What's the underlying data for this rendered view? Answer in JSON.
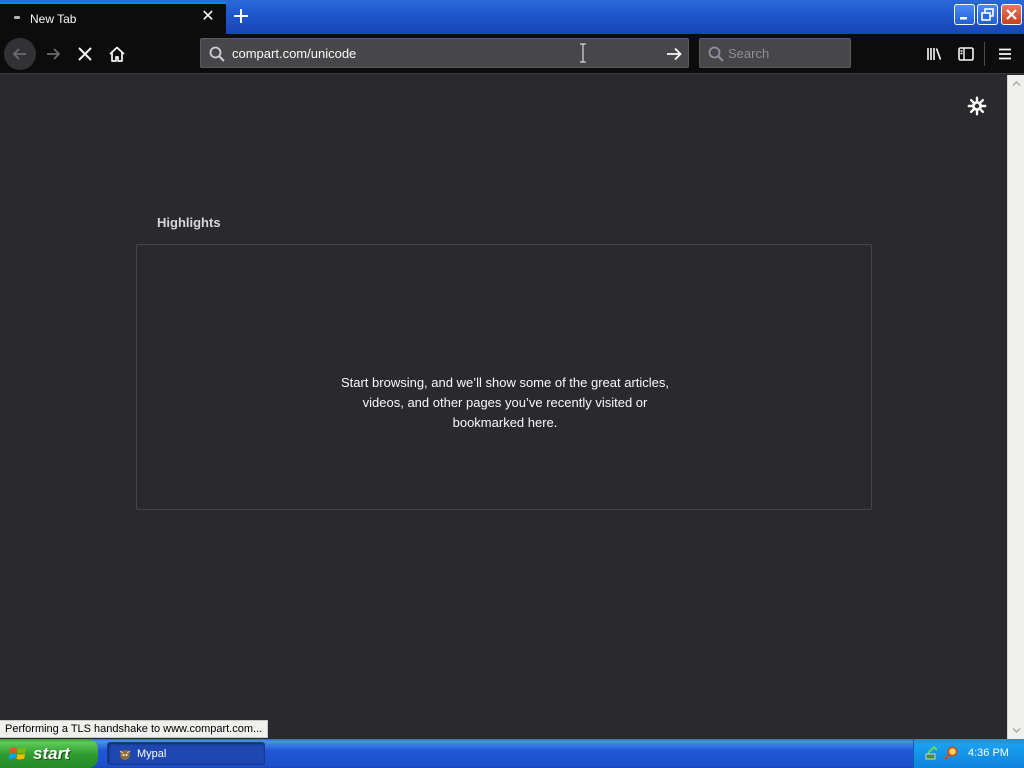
{
  "browser": {
    "tab": {
      "title": "New Tab",
      "close_icon": "close-icon"
    },
    "window_controls": [
      "minimize-icon",
      "restore-icon",
      "close-icon"
    ],
    "urlbar": {
      "value": "compart.com/unicode"
    },
    "searchbar": {
      "placeholder": "Search"
    },
    "toolbar_icons": [
      "back-arrow-icon",
      "forward-arrow-icon",
      "stop-icon",
      "home-icon",
      "library-icon",
      "sidebar-icon",
      "hamburger-menu-icon"
    ]
  },
  "newtab": {
    "highlights_title": "Highlights",
    "highlights_message": "Start browsing, and we’ll show some of the great articles, videos, and other pages you’ve recently visited or bookmarked here."
  },
  "status_bar": {
    "text": "Performing a TLS handshake to www.compart.com..."
  },
  "taskbar": {
    "start_label": "start",
    "tasks": [
      {
        "label": "Mypal"
      }
    ],
    "clock": "4:36 PM"
  },
  "colors": {
    "accent": "#0a84ff",
    "content_bg": "#2a2a2e",
    "toolbar_bg": "#0c0c0d",
    "xp_title_blue": "#1f56cc",
    "xp_start_green": "#2f9b2f"
  }
}
